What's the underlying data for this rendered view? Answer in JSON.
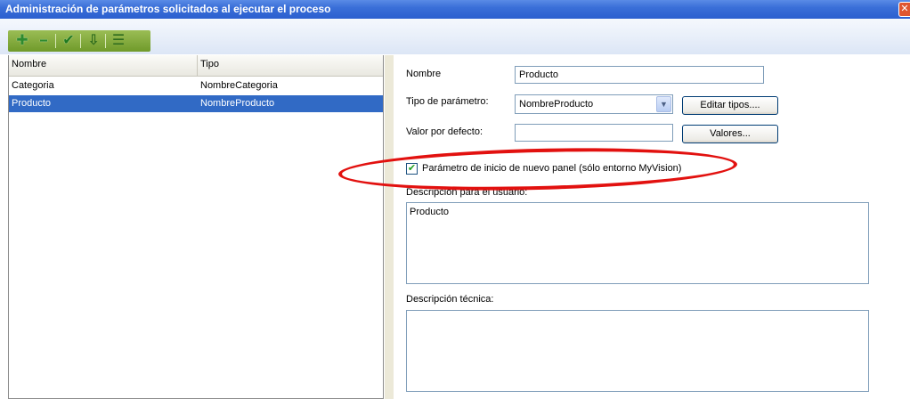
{
  "window": {
    "title": "Administración de parámetros solicitados al ejecutar el proceso",
    "close_glyph": "✕"
  },
  "toolbar": {
    "buttons": [
      {
        "icon": "plus-icon",
        "glyph": "✚"
      },
      {
        "icon": "minus-icon",
        "glyph": "━"
      },
      {
        "icon": "checkmark-icon",
        "glyph": "✔"
      },
      {
        "icon": "import-icon",
        "glyph": "⇩"
      },
      {
        "icon": "sort-icon",
        "glyph": "☰"
      }
    ],
    "colors": {
      "strip": "#7ea63a"
    }
  },
  "list": {
    "columns": [
      "Nombre",
      "Tipo"
    ],
    "rows": [
      {
        "nombre": "Categoria",
        "tipo": "NombreCategoria",
        "selected": false
      },
      {
        "nombre": "Producto",
        "tipo": "NombreProducto",
        "selected": true
      }
    ]
  },
  "form": {
    "nombre_label": "Nombre",
    "nombre_value": "Producto",
    "tipo_label": "Tipo de parámetro:",
    "tipo_value": "NombreProducto",
    "editar_tipos_label": "Editar tipos....",
    "valor_label": "Valor por defecto:",
    "valor_value": "",
    "valores_label": "Valores...",
    "checkbox_label": "Parámetro de inicio de nuevo panel (sólo entorno MyVision)",
    "checkbox_checked": true,
    "desc_usuario_label": "Descripción para el usuario:",
    "desc_usuario_value": "Producto",
    "desc_tecnica_label": "Descripción técnica:",
    "desc_tecnica_value": ""
  },
  "colors": {
    "titlebar": "#2b5fcf",
    "selection": "#316ac5",
    "callout": "#e2110f"
  }
}
